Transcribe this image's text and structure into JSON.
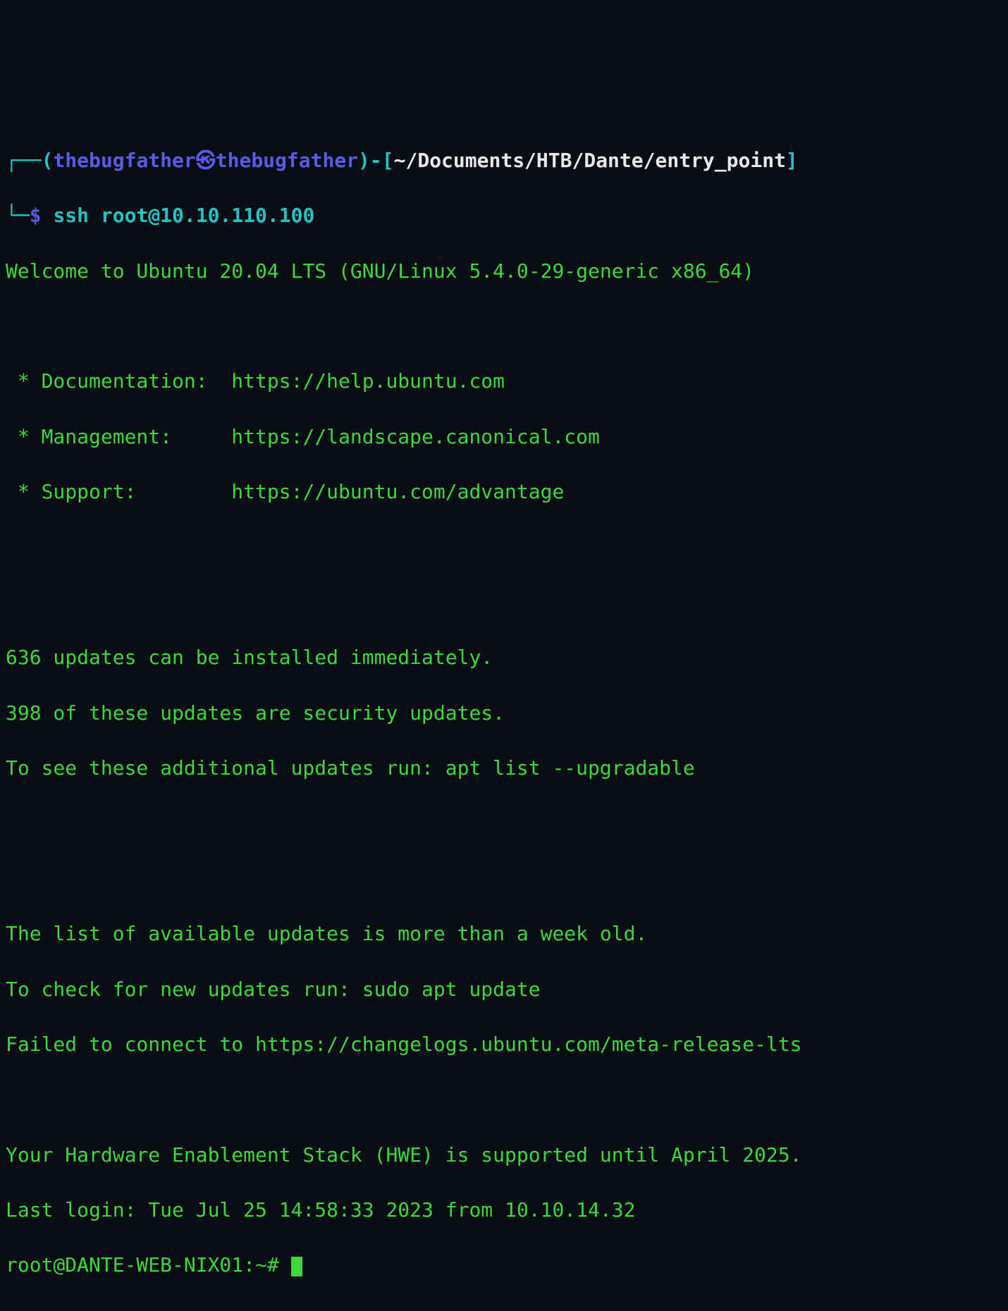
{
  "prompt": {
    "user": "thebugfather",
    "host": "thebugfather",
    "cwd": "~/Documents/HTB/Dante/entry_point",
    "dollar": "$",
    "cmd": "ssh root@10.10.110.100"
  },
  "motd": {
    "welcome": "Welcome to Ubuntu 20.04 LTS (GNU/Linux 5.4.0-29-generic x86_64)",
    "links": {
      "doc_label": " * Documentation:  ",
      "doc_url": "https://help.ubuntu.com",
      "mgmt_label": " * Management:     ",
      "mgmt_url": "https://landscape.canonical.com",
      "support_label": " * Support:        ",
      "support_url": "https://ubuntu.com/advantage"
    },
    "updates1": "636 updates can be installed immediately.",
    "updates2": "398 of these updates are security updates.",
    "updates3": "To see these additional updates run: apt list --upgradable",
    "stale1": "The list of available updates is more than a week old.",
    "stale2": "To check for new updates run: sudo apt update",
    "failed": "Failed to connect to https://changelogs.ubuntu.com/meta-release-lts",
    "hwe": "Your Hardware Enablement Stack (HWE) is supported until April 2025.",
    "lastlogin": "Last login: Tue Jul 25 14:58:33 2023 from 10.10.14.32"
  },
  "remote_prompt": "root@DANTE-WEB-NIX01:~# "
}
